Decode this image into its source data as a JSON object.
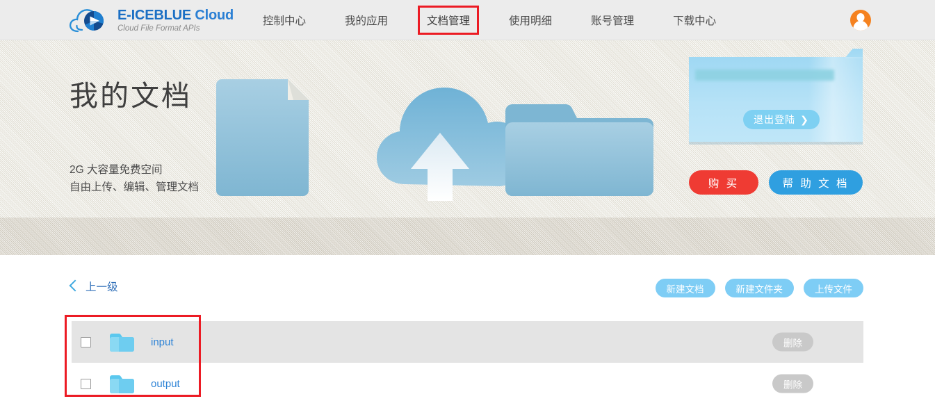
{
  "header": {
    "logo": {
      "icon": "cloud-logo-icon",
      "title_primary": "E-ICEBLUE",
      "title_secondary": "Cloud",
      "subtitle": "Cloud File Format APIs"
    },
    "nav": [
      {
        "label": "控制中心",
        "active": false
      },
      {
        "label": "我的应用",
        "active": false
      },
      {
        "label": "文档管理",
        "active": true
      },
      {
        "label": "使用明细",
        "active": false
      },
      {
        "label": "账号管理",
        "active": false
      },
      {
        "label": "下载中心",
        "active": false
      }
    ],
    "avatar": {
      "icon": "user-avatar-icon",
      "color": "#f58220"
    }
  },
  "hero": {
    "title": "我的文档",
    "subtitle_line1": "2G 大容量免费空间",
    "subtitle_line2": "自由上传、编辑、管理文档",
    "illustration": [
      "document-icon",
      "upload-cloud-icon",
      "folder-icon"
    ],
    "account_panel": {
      "masked_account": "",
      "logout_label": "退出登陆",
      "logout_chevron": "❯"
    },
    "buy_label": "购 买",
    "help_label": "帮 助 文 档"
  },
  "content": {
    "up_level_label": "上一级",
    "toolbar": [
      {
        "label": "新建文档"
      },
      {
        "label": "新建文件夹"
      },
      {
        "label": "上传文件"
      }
    ],
    "rows": [
      {
        "name": "input",
        "type": "folder",
        "checked": false,
        "delete_label": "删除",
        "highlighted": true
      },
      {
        "name": "output",
        "type": "folder",
        "checked": false,
        "delete_label": "删除",
        "highlighted": false
      }
    ]
  },
  "colors": {
    "brand_blue": "#1b6fc4",
    "accent_light_blue": "#7ecdf5",
    "buy_red": "#ef3b33",
    "help_blue": "#2f9fe0",
    "annotation_red": "#ec1b24",
    "avatar_orange": "#f58220"
  }
}
